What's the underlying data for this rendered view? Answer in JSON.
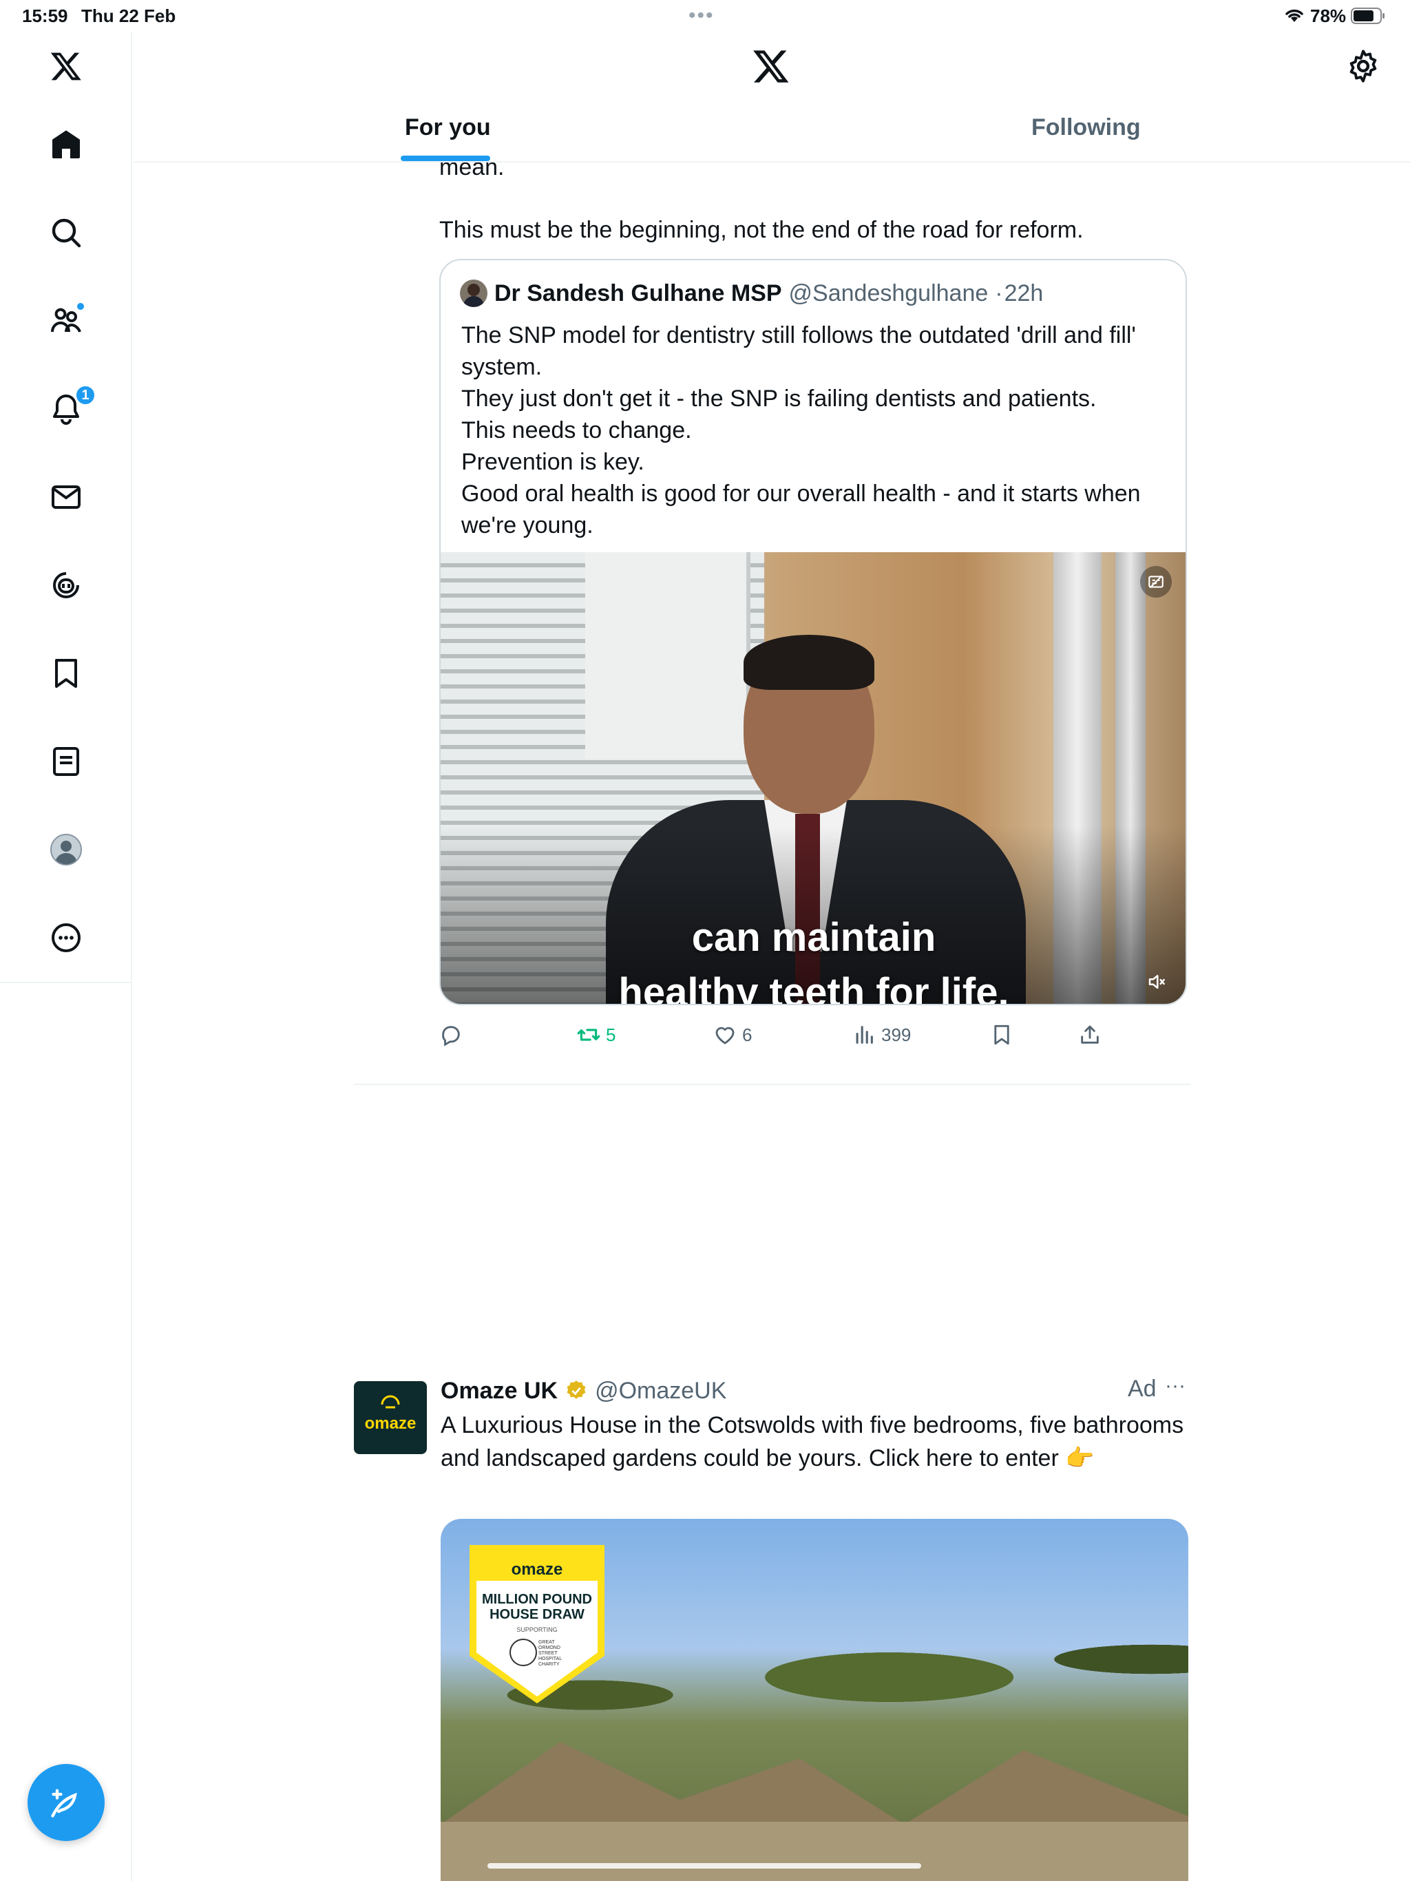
{
  "status_bar": {
    "time": "15:59",
    "date": "Thu 22 Feb",
    "battery_percent": "78%",
    "battery_level": 0.78
  },
  "colors": {
    "accent": "#1d9bf0",
    "text_primary": "#0f1419",
    "text_secondary": "#536471",
    "retweet_active": "#00ba7c",
    "border": "#eff3f4"
  },
  "sidebar": {
    "items": [
      {
        "name": "x-logo",
        "icon": "x-logo-icon"
      },
      {
        "name": "home",
        "icon": "home-icon"
      },
      {
        "name": "explore",
        "icon": "search-icon"
      },
      {
        "name": "communities",
        "icon": "communities-icon",
        "dot": true
      },
      {
        "name": "notifications",
        "icon": "bell-icon",
        "badge": "1"
      },
      {
        "name": "messages",
        "icon": "mail-icon"
      },
      {
        "name": "grok",
        "icon": "grok-icon"
      },
      {
        "name": "bookmarks",
        "icon": "bookmark-icon"
      },
      {
        "name": "lists",
        "icon": "lists-icon"
      },
      {
        "name": "profile",
        "icon": "profile-avatar-icon"
      },
      {
        "name": "more",
        "icon": "more-circle-icon"
      }
    ],
    "compose_icon": "compose-feather-icon"
  },
  "header": {
    "tabs": [
      {
        "label": "For you",
        "active": true
      },
      {
        "label": "Following",
        "active": false
      }
    ]
  },
  "tweet": {
    "clipped_text": "mean.",
    "text": "This must be the beginning, not the end of the road for reform.",
    "quote": {
      "author_name": "Dr Sandesh Gulhane MSP",
      "author_handle": "@Sandeshgulhane",
      "separator": "·",
      "time": "22h",
      "body": "The SNP model for dentistry still follows the outdated 'drill and fill' system.\nThey just don't get it - the SNP is failing dentists and patients.\nThis needs to change.\nPrevention is key.\nGood oral health is good for our overall health - and it starts when we're young.",
      "video_caption_line1": "can maintain",
      "video_caption_line2": "healthy teeth for life."
    },
    "actions": {
      "reply_count": "",
      "retweet_count": "5",
      "like_count": "6",
      "views_count": "399"
    }
  },
  "ad": {
    "logo_text": "omaze",
    "name": "Omaze UK",
    "handle": "@OmazeUK",
    "label": "Ad",
    "more": "···",
    "text": "A Luxurious House in the Cotswolds with five bedrooms, five bathrooms and landscaped gardens could be yours. Click here to enter 👉",
    "media_badge": {
      "brand": "omaze",
      "title": "MILLION POUND HOUSE DRAW",
      "sub": "SUPPORTING",
      "charity": "GREAT ORMOND STREET HOSPITAL CHARITY"
    }
  }
}
